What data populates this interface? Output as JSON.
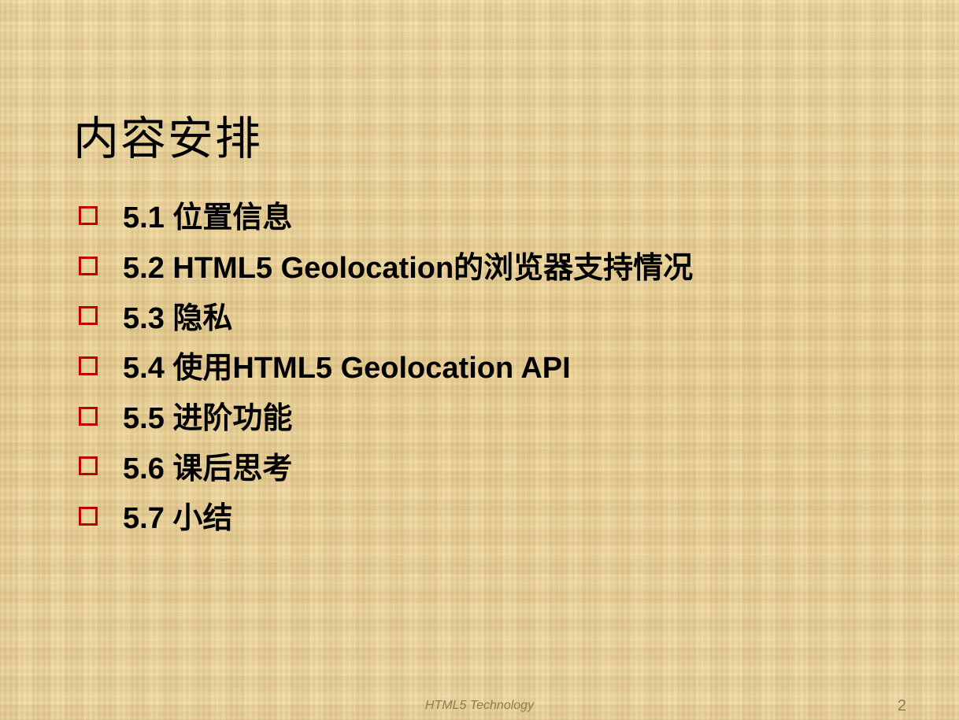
{
  "slide": {
    "title": "内容安排",
    "bullets": [
      {
        "label": "5.1 位置信息"
      },
      {
        "label": "5.2 HTML5 Geolocation的浏览器支持情况"
      },
      {
        "label": "5.3 隐私"
      },
      {
        "label": "5.4 使用HTML5 Geolocation API"
      },
      {
        "label": "5.5 进阶功能"
      },
      {
        "label": "5.6 课后思考"
      },
      {
        "label": "5.7 小结"
      }
    ],
    "footer": "HTML5 Technology",
    "page_number": "2"
  },
  "colors": {
    "bullet_accent": "#c00000",
    "background": "#efd9a3",
    "footer_text": "#8a7a55"
  },
  "icons": {
    "bullet": "hollow-square-icon"
  }
}
